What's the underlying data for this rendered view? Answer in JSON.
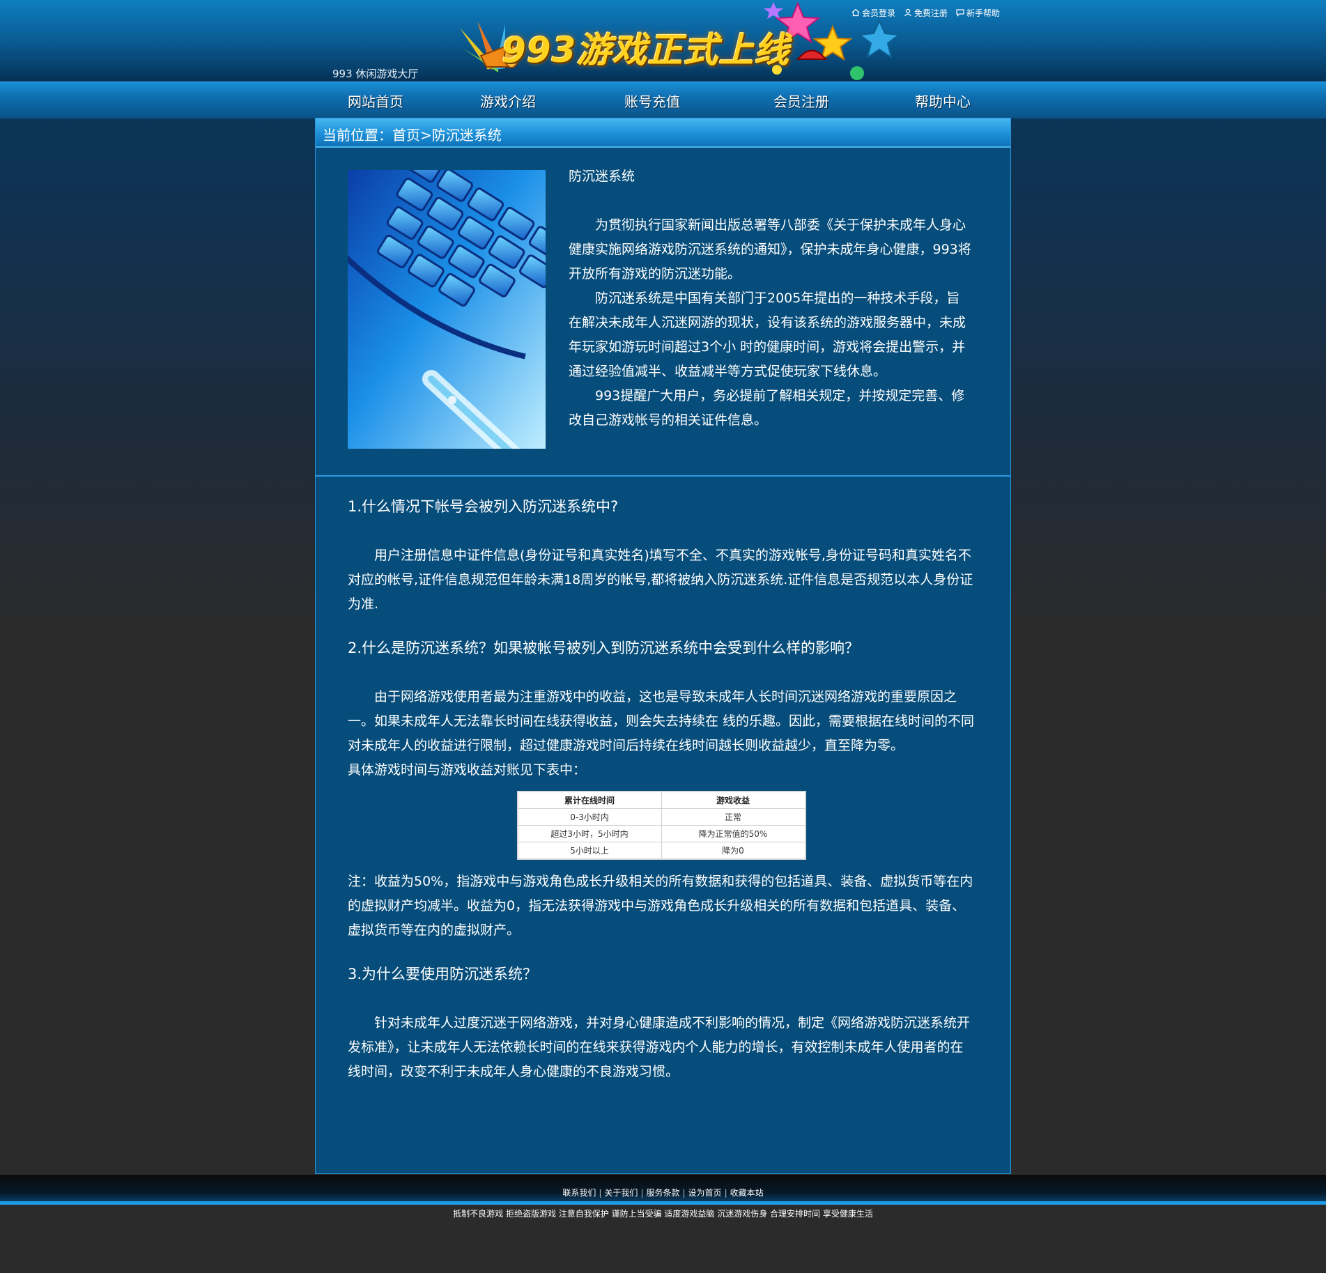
{
  "header": {
    "site_name": "993 休闲游戏大厅",
    "banner_title": "993游戏正式上线",
    "top_links": [
      {
        "label": "会员登录",
        "icon": "home-icon"
      },
      {
        "label": "免费注册",
        "icon": "user-icon"
      },
      {
        "label": "新手帮助",
        "icon": "chat-icon"
      }
    ]
  },
  "nav": {
    "items": [
      {
        "label": "网站首页"
      },
      {
        "label": "游戏介绍"
      },
      {
        "label": "账号充值"
      },
      {
        "label": "会员注册"
      },
      {
        "label": "帮助中心"
      }
    ]
  },
  "breadcrumb": "当前位置：首页>防沉迷系统",
  "intro": {
    "title": "防沉迷系统",
    "paragraphs": [
      "为贯彻执行国家新闻出版总署等八部委《关于保护未成年人身心健康实施网络游戏防沉迷系统的通知》，保护未成年身心健康，993将开放所有游戏的防沉迷功能。",
      "防沉迷系统是中国有关部门于2005年提出的一种技术手段，旨在解决未成年人沉迷网游的现状，设有该系统的游戏服务器中，未成年玩家如游玩时间超过3个小 时的健康时间，游戏将会提出警示，并通过经验值减半、收益减半等方式促使玩家下线休息。",
      "993提醒广大用户，务必提前了解相关规定，并按规定完善、修改自己游戏帐号的相关证件信息。"
    ]
  },
  "faq": {
    "q1": "1.什么情况下帐号会被列入防沉迷系统中?",
    "a1": "用户注册信息中证件信息(身份证号和真实姓名)填写不全、不真实的游戏帐号,身份证号码和真实姓名不对应的帐号,证件信息规范但年龄未满18周岁的帐号,都将被纳入防沉迷系统.证件信息是否规范以本人身份证为准.",
    "q2": "2.什么是防沉迷系统？如果被帐号被列入到防沉迷系统中会受到什么样的影响？",
    "a2": "由于网络游戏使用者最为注重游戏中的收益，这也是导致未成年人长时间沉迷网络游戏的重要原因之一。如果未成年人无法靠长时间在线获得收益，则会失去持续在 线的乐趣。因此，需要根据在线时间的不同对未成年人的收益进行限制，超过健康游戏时间后持续在线时间越长则收益越少，直至降为零。",
    "a2_table_intro": "具体游戏时间与游戏收益对账见下表中：",
    "table": {
      "headers": [
        "累计在线时间",
        "游戏收益"
      ],
      "rows": [
        [
          "0-3小时内",
          "正常"
        ],
        [
          "超过3小时，5小时内",
          "降为正常值的50%"
        ],
        [
          "5小时以上",
          "降为0"
        ]
      ]
    },
    "note": "注：收益为50%，指游戏中与游戏角色成长升级相关的所有数据和获得的包括道具、装备、虚拟货币等在内的虚拟财产均减半。收益为0，指无法获得游戏中与游戏角色成长升级相关的所有数据和包括道具、装备、虚拟货币等在内的虚拟财产。",
    "q3": "3.为什么要使用防沉迷系统？",
    "a3": "针对未成年人过度沉迷于网络游戏，并对身心健康造成不利影响的情况，制定《网络游戏防沉迷系统开发标准》，让未成年人无法依赖长时间的在线来获得游戏内个人能力的增长，有效控制未成年人使用者的在线时间，改变不利于未成年人身心健康的不良游戏习惯。"
  },
  "footer": {
    "links": [
      "联系我们",
      "关于我们",
      "服务条款",
      "设为首页",
      "收藏本站"
    ],
    "separator": "|",
    "slogan": "抵制不良游戏 拒绝盗版游戏 注意自我保护 谨防上当受骗 适度游戏益脑 沉迷游戏伤身 合理安排时间 享受健康生活"
  }
}
